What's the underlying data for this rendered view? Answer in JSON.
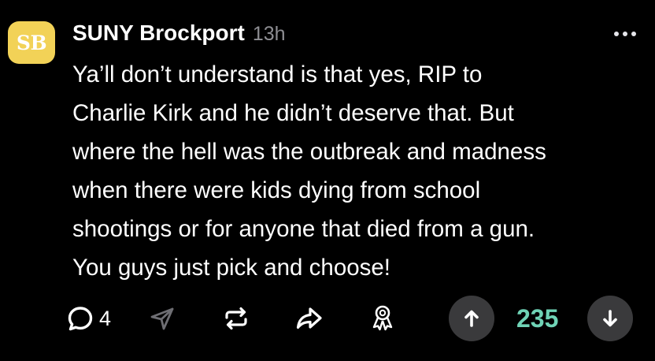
{
  "post": {
    "avatar_text": "SB",
    "author": "SUNY Brockport",
    "time": "13h",
    "lines": [
      "Ya’ll don’t understand is that yes, RIP to",
      "Charlie Kirk and he didn’t deserve that. But",
      "where the hell was the outbreak and madness",
      "when there were kids dying from school",
      "shootings or for anyone that died from a gun.",
      "You guys just pick and choose!"
    ]
  },
  "actions": {
    "comment_count": "4",
    "score": "235"
  },
  "colors": {
    "background": "#000000",
    "avatar": "#f2d257",
    "score": "#6fd3b6",
    "vote_button": "#3a3a3c",
    "muted": "#8e8e93"
  },
  "icons": [
    "comment-icon",
    "share-send-icon",
    "repost-icon",
    "forward-icon",
    "award-icon",
    "upvote-icon",
    "downvote-icon",
    "more-icon"
  ]
}
